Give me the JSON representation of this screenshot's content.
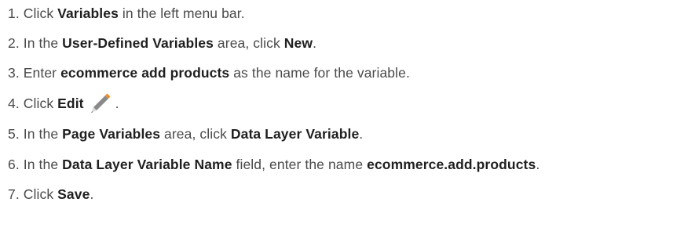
{
  "steps": [
    {
      "num": "1.",
      "parts": [
        {
          "t": "Click ",
          "b": false
        },
        {
          "t": "Variables",
          "b": true
        },
        {
          "t": " in the left menu bar.",
          "b": false
        }
      ]
    },
    {
      "num": "2.",
      "parts": [
        {
          "t": "In the ",
          "b": false
        },
        {
          "t": "User-Defined Variables",
          "b": true
        },
        {
          "t": " area, click ",
          "b": false
        },
        {
          "t": "New",
          "b": true
        },
        {
          "t": ".",
          "b": false
        }
      ]
    },
    {
      "num": "3.",
      "parts": [
        {
          "t": "Enter ",
          "b": false
        },
        {
          "t": "ecommerce add products",
          "b": true
        },
        {
          "t": " as the name for the variable.",
          "b": false
        }
      ]
    },
    {
      "num": "4.",
      "parts": [
        {
          "t": "Click ",
          "b": false
        },
        {
          "t": "Edit",
          "b": true
        },
        {
          "icon": "pencil-icon"
        },
        {
          "t": ".",
          "b": false
        }
      ]
    },
    {
      "num": "5.",
      "parts": [
        {
          "t": "In the ",
          "b": false
        },
        {
          "t": "Page Variables",
          "b": true
        },
        {
          "t": " area, click ",
          "b": false
        },
        {
          "t": "Data Layer Variable",
          "b": true
        },
        {
          "t": ".",
          "b": false
        }
      ]
    },
    {
      "num": "6.",
      "parts": [
        {
          "t": "In the ",
          "b": false
        },
        {
          "t": "Data Layer Variable Name",
          "b": true
        },
        {
          "t": " field, enter the name ",
          "b": false
        },
        {
          "t": "ecommerce.add.products",
          "b": true
        },
        {
          "t": ".",
          "b": false
        }
      ]
    },
    {
      "num": "7.",
      "parts": [
        {
          "t": "Click ",
          "b": false
        },
        {
          "t": "Save",
          "b": true
        },
        {
          "t": ".",
          "b": false
        }
      ]
    }
  ],
  "colors": {
    "text": "#4a4a4a",
    "bold": "#1f1f1f",
    "pencil_body": "#8a8a8a",
    "pencil_tip": "#f08a24"
  }
}
